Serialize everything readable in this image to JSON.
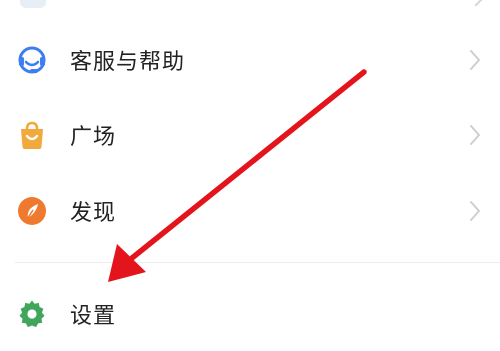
{
  "menu": {
    "items": [
      {
        "label": "客服与帮助",
        "icon": "headset-icon",
        "color": "#3d7ff0",
        "has_chevron": true
      },
      {
        "label": "广场",
        "icon": "shopping-bag-icon",
        "color": "#f2a93b",
        "has_chevron": true
      },
      {
        "label": "发现",
        "icon": "compass-icon",
        "color": "#ef7a2f",
        "has_chevron": true
      },
      {
        "label": "设置",
        "icon": "gear-icon",
        "color": "#42a55c",
        "has_chevron": false
      }
    ]
  },
  "annotation": {
    "arrow_color": "#e3141c"
  }
}
